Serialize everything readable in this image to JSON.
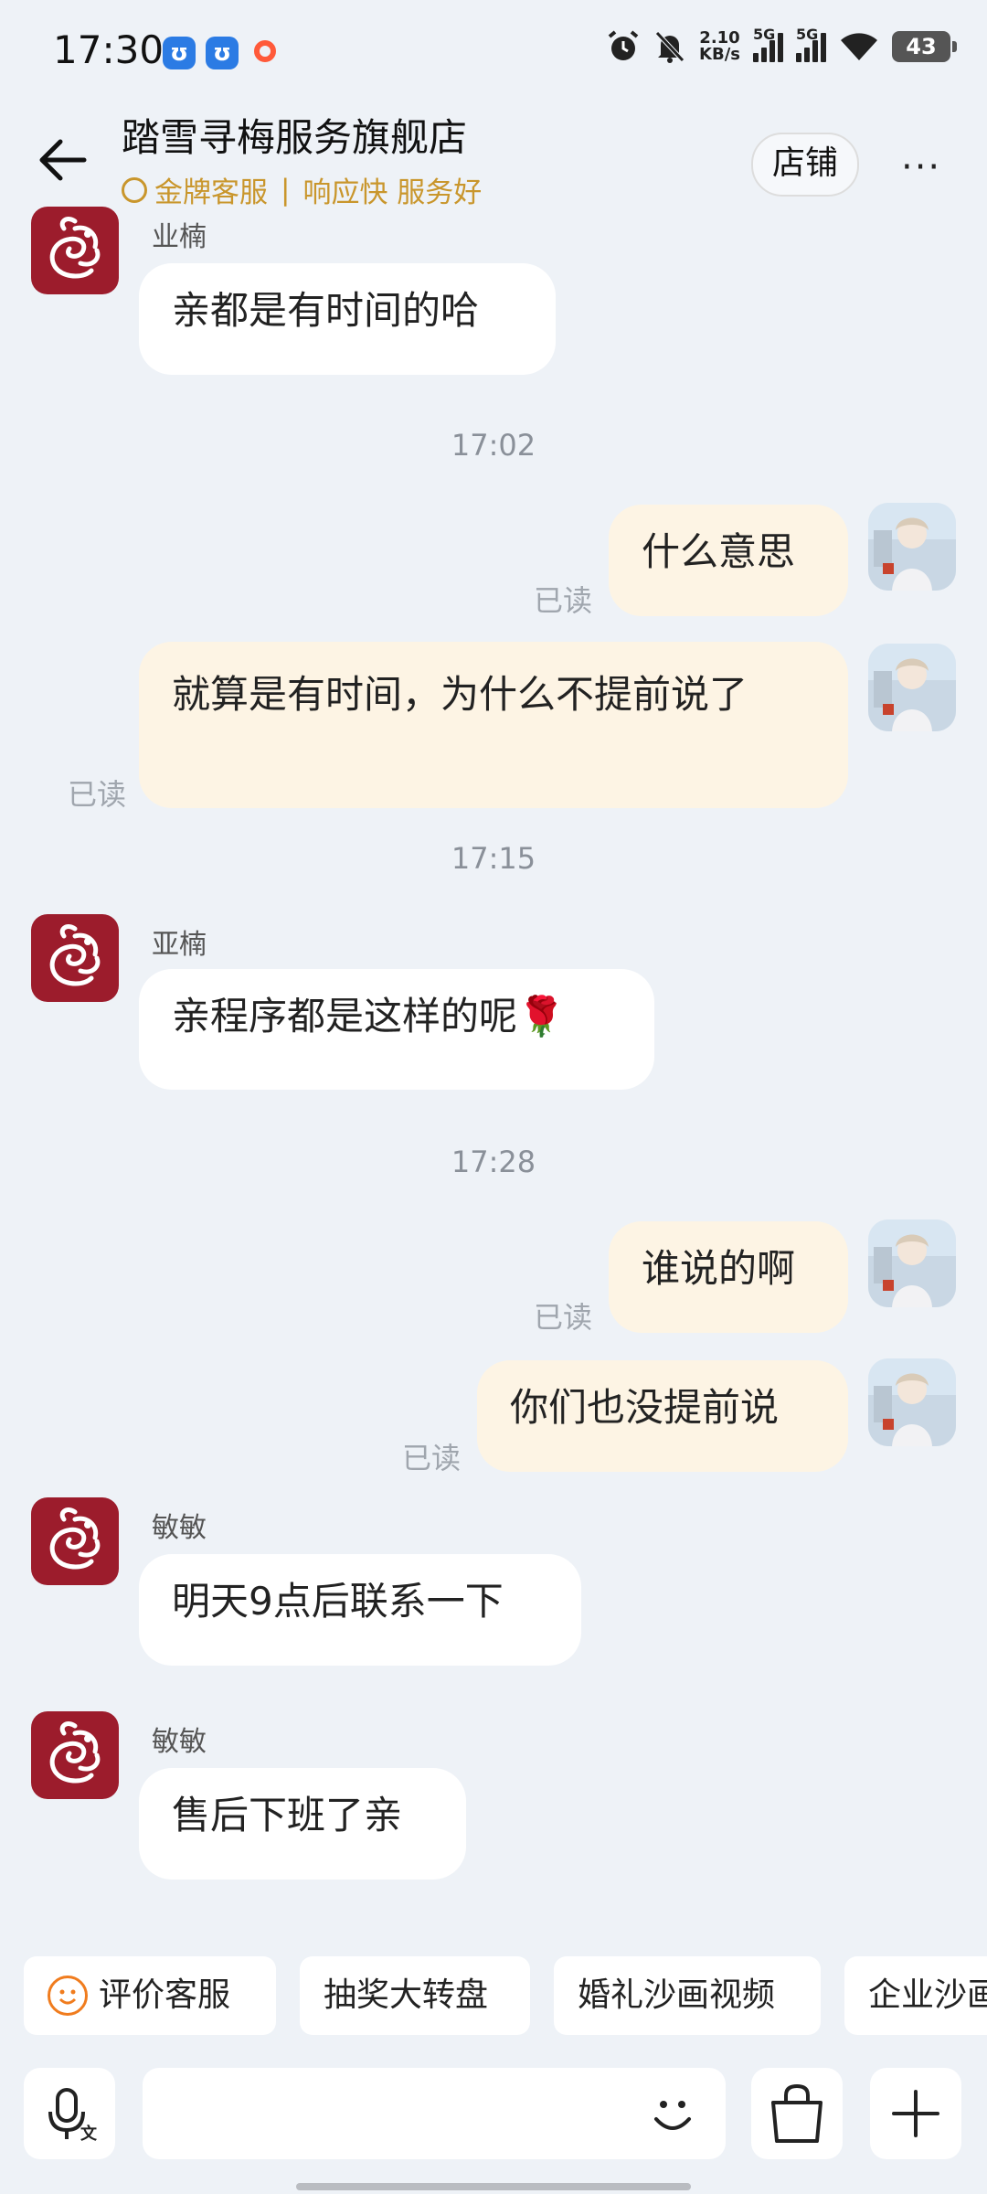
{
  "status_bar": {
    "time": "17:30",
    "network_speed": "2.10",
    "network_unit": "KB/s",
    "sim1": "5G",
    "sim2": "5G",
    "battery": "43"
  },
  "header": {
    "title": "踏雪寻梅服务旗舰店",
    "badge": "金牌客服",
    "tagline": "响应快 服务好",
    "store_button": "店铺",
    "more": "···"
  },
  "messages": [
    {
      "type": "in",
      "sender": "业楠",
      "text": "亲都是有时间的哈"
    },
    {
      "type": "time",
      "text": "17:02"
    },
    {
      "type": "out",
      "text": "什么意思",
      "status": "已读"
    },
    {
      "type": "out",
      "text": "就算是有时间，为什么不提前说了",
      "status": "已读"
    },
    {
      "type": "time",
      "text": "17:15"
    },
    {
      "type": "in",
      "sender": "亚楠",
      "text": "亲程序都是这样的呢🌹"
    },
    {
      "type": "time",
      "text": "17:28"
    },
    {
      "type": "out",
      "text": "谁说的啊",
      "status": "已读"
    },
    {
      "type": "out",
      "text": "你们也没提前说",
      "status": "已读"
    },
    {
      "type": "in",
      "sender": "敏敏",
      "text": "明天9点后联系一下"
    },
    {
      "type": "in",
      "sender": "敏敏",
      "text": "售后下班了亲"
    }
  ],
  "quick_actions": [
    "评价客服",
    "抽奖大转盘",
    "婚礼沙画视频",
    "企业沙画"
  ],
  "input": {
    "voice_label": "文"
  },
  "colors": {
    "accent_gold": "#c9962c",
    "outgoing_bubble": "#fdf4e4",
    "shop_avatar": "#9c1c2c"
  }
}
